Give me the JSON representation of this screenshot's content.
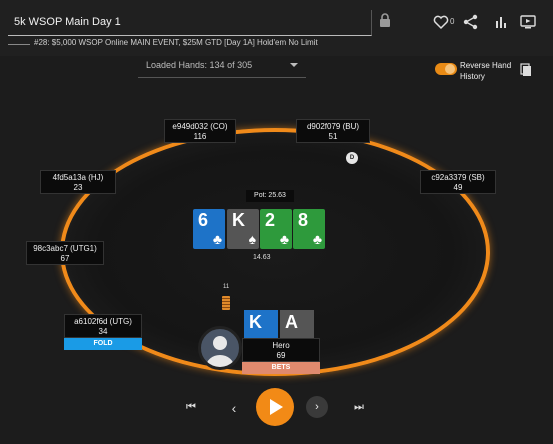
{
  "header": {
    "title": "5k WSOP Main Day 1",
    "subtitle": "#28: $5,000 WSOP Online MAIN EVENT, $25M GTD [Day 1A] Hold'em No Limit",
    "like_count": "0"
  },
  "loaded_hands": {
    "label": "Loaded Hands: 134 of 305"
  },
  "reverse_history": {
    "label_line1": "Reverse Hand",
    "label_line2": "History",
    "enabled": true
  },
  "table": {
    "pot_label": "Pot: 25.63",
    "pot_amount_below": "14.63",
    "hero_bet_chips": "11",
    "board": [
      {
        "rank": "6",
        "suit": "♣",
        "color": "#1e73c8"
      },
      {
        "rank": "K",
        "suit": "♠",
        "color": "#555555"
      },
      {
        "rank": "2",
        "suit": "♣",
        "color": "#2e9a3c"
      },
      {
        "rank": "8",
        "suit": "♣",
        "color": "#2e9a3c"
      }
    ],
    "seats": [
      {
        "id": "e949d032 (CO)",
        "stack": "116"
      },
      {
        "id": "d902f079 (BU)",
        "stack": "51"
      },
      {
        "id": "4fd5a13a (HJ)",
        "stack": "23"
      },
      {
        "id": "c92a3379 (SB)",
        "stack": "49"
      },
      {
        "id": "98c3abc7 (UTG1)",
        "stack": "67"
      },
      {
        "id": "a6102f6d (UTG)",
        "stack": "34",
        "action": "FOLD"
      }
    ],
    "hero": {
      "name": "Hero",
      "stack": "69",
      "action": "BETS",
      "cards": [
        {
          "rank": "K",
          "color": "#1e73c8"
        },
        {
          "rank": "A",
          "color": "#555555"
        }
      ]
    },
    "dealer_button": "D"
  },
  "controls": {
    "first": "⏮",
    "prev": "‹",
    "next": "›",
    "last": "⏭"
  },
  "colors": {
    "accent": "#f28a16",
    "fold": "#1a9be6",
    "bets": "#e08a6e"
  }
}
